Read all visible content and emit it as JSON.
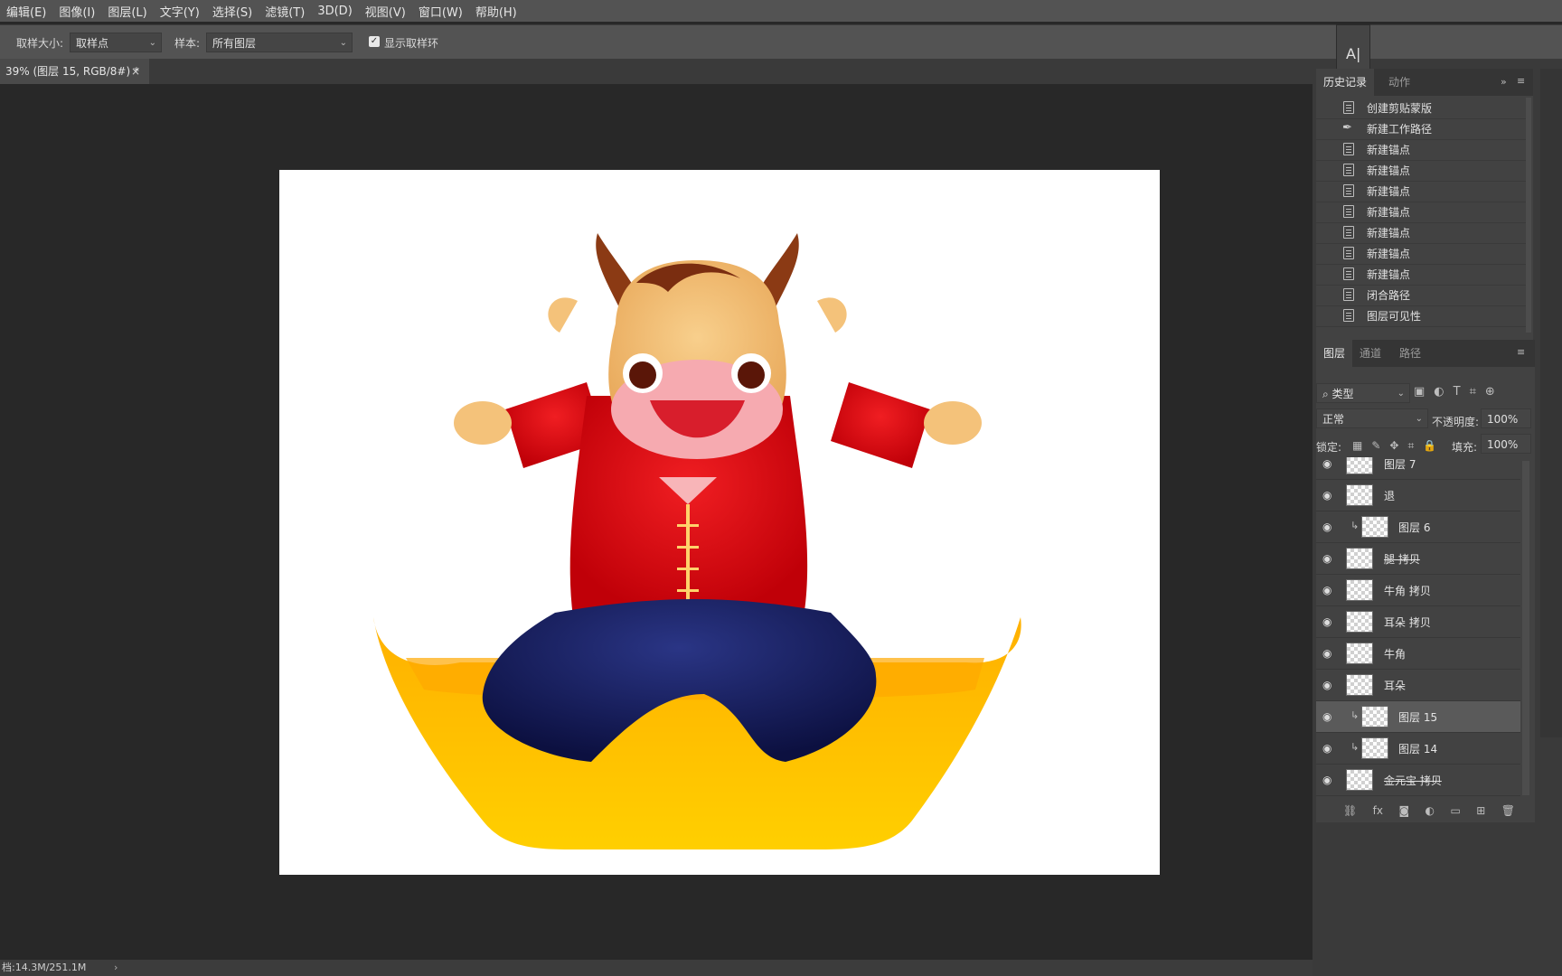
{
  "menu": [
    "编辑(E)",
    "图像(I)",
    "图层(L)",
    "文字(Y)",
    "选择(S)",
    "滤镜(T)",
    "3D(D)",
    "视图(V)",
    "窗口(W)",
    "帮助(H)"
  ],
  "options": {
    "sample_size_label": "取样大小:",
    "sample_size_value": "取样点",
    "sample_label": "样本:",
    "sample_value": "所有图层",
    "show_ring_label": "显示取样环"
  },
  "document_tab": {
    "title": "39% (图层 15, RGB/8#) *",
    "close": "×"
  },
  "status": {
    "doc_size": "档:14.3M/251.1M",
    "arrow": "›"
  },
  "history_panel": {
    "tabs": [
      "历史记录",
      "动作"
    ],
    "items": [
      "创建剪贴蒙版",
      "新建工作路径",
      "新建锚点",
      "新建锚点",
      "新建锚点",
      "新建锚点",
      "新建锚点",
      "新建锚点",
      "新建锚点",
      "闭合路径",
      "图层可见性"
    ]
  },
  "layers_panel": {
    "tabs": [
      "图层",
      "通道",
      "路径"
    ],
    "filter": "类型",
    "blend_mode": "正常",
    "opacity_label": "不透明度:",
    "opacity_value": "100%",
    "lock_label": "锁定:",
    "fill_label": "填充:",
    "fill_value": "100%",
    "layers": [
      {
        "name": "图层 7",
        "clipped": false
      },
      {
        "name": "退",
        "clipped": false
      },
      {
        "name": "图层 6",
        "clipped": true
      },
      {
        "name": "腿 拷贝",
        "clipped": false
      },
      {
        "name": "牛角 拷贝",
        "clipped": false
      },
      {
        "name": "耳朵 拷贝",
        "clipped": false
      },
      {
        "name": "牛角",
        "clipped": false
      },
      {
        "name": "耳朵",
        "clipped": false
      },
      {
        "name": "图层 15",
        "clipped": true,
        "selected": true
      },
      {
        "name": "图层 14",
        "clipped": true
      },
      {
        "name": "金元宝 拷贝",
        "clipped": false
      }
    ]
  },
  "colors": {
    "shirt": "#e8151b",
    "pants": "#1c2466",
    "gold": "#ffc400",
    "face": "#f6c27a"
  }
}
